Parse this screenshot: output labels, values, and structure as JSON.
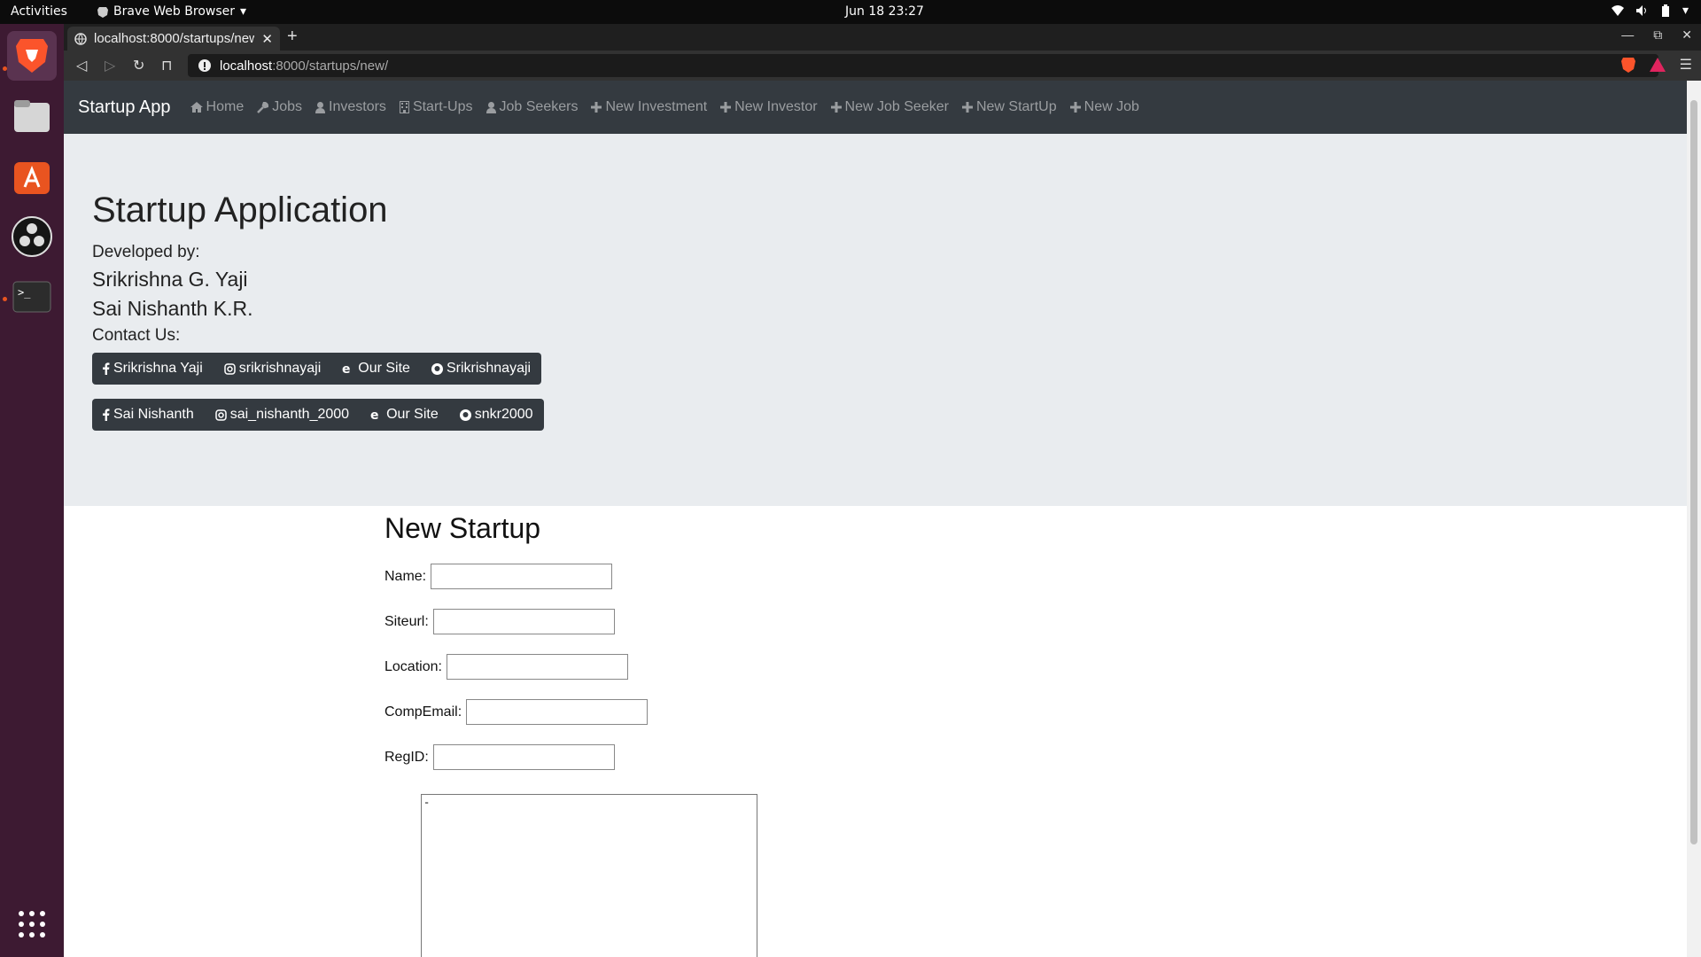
{
  "os": {
    "activities": "Activities",
    "app_name": "Brave Web Browser",
    "clock": "Jun 18  23:27"
  },
  "browser": {
    "tab_title": "localhost:8000/startups/new/",
    "url_host": "localhost",
    "url_path": ":8000/startups/new/"
  },
  "navbar": {
    "brand": "Startup App",
    "links": [
      {
        "label": "Home",
        "icon": "home-icon"
      },
      {
        "label": "Jobs",
        "icon": "wrench-icon"
      },
      {
        "label": "Investors",
        "icon": "user-icon"
      },
      {
        "label": "Start-Ups",
        "icon": "building-icon"
      },
      {
        "label": "Job Seekers",
        "icon": "user-icon"
      },
      {
        "label": "New Investment",
        "icon": "plus-icon"
      },
      {
        "label": "New Investor",
        "icon": "plus-icon"
      },
      {
        "label": "New Job Seeker",
        "icon": "plus-icon"
      },
      {
        "label": "New StartUp",
        "icon": "plus-icon"
      },
      {
        "label": "New Job",
        "icon": "plus-icon"
      }
    ]
  },
  "jumbotron": {
    "title": "Startup Application",
    "developed_by": "Developed by:",
    "dev1": "Srikrishna G. Yaji",
    "dev2": "Sai Nishanth K.R.",
    "contact": "Contact Us:",
    "group1": [
      "Srikrishna Yaji",
      "srikrishnayaji",
      "Our Site",
      "Srikrishnayaji"
    ],
    "group2": [
      "Sai Nishanth",
      "sai_nishanth_2000",
      "Our Site",
      "snkr2000"
    ]
  },
  "form": {
    "title": "New Startup",
    "labels": [
      "Name:",
      "Siteurl:",
      "Location:",
      "CompEmail:",
      "RegID:"
    ],
    "textarea_value": "-"
  },
  "colors": {
    "navbar_bg": "#343a40",
    "jumbotron_bg": "#e9ecef",
    "dock_bg": "#3d1a32"
  }
}
